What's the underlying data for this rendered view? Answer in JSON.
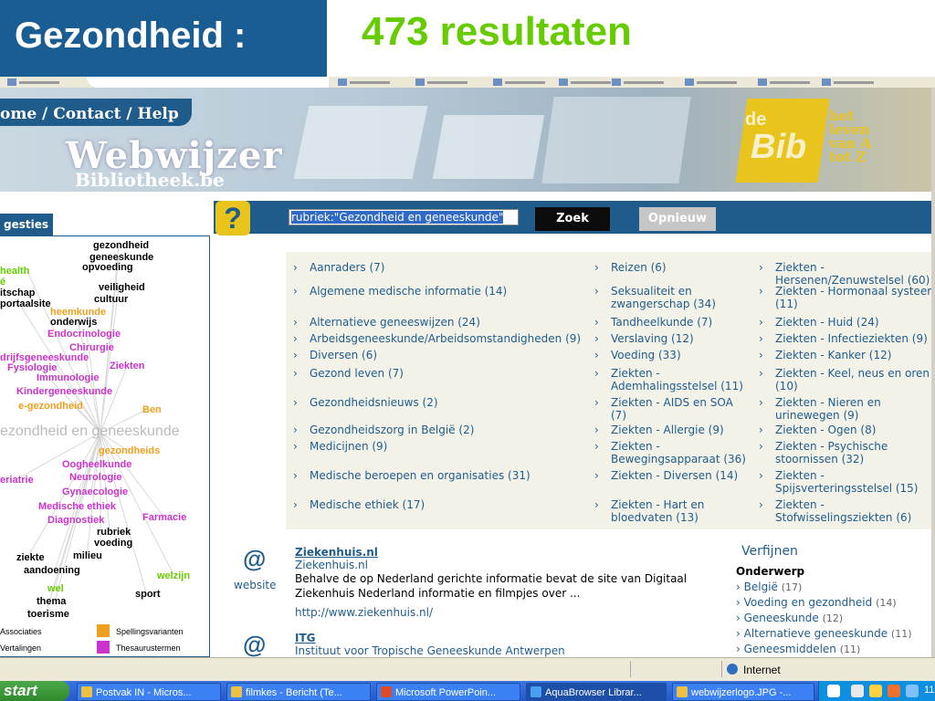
{
  "slide": {
    "title": "Gezondheid :",
    "result_count": "473 resultaten"
  },
  "site": {
    "nav": "ome / Contact / Help",
    "logo_title": "Webwijzer",
    "logo_sub": "Bibliotheek.be",
    "bib_de": "de",
    "bib_logo": "Bib",
    "bib_slogan": [
      "het",
      "leven",
      "van A",
      "tot Z"
    ]
  },
  "search": {
    "query": "rubriek:\"Gezondheid en geneeskunde\"",
    "search_button": "Zoek",
    "reset_button": "Opnieuw"
  },
  "sidebar": {
    "tab": "gesties",
    "center_term": "ezondheid en geneeskunde",
    "cloud": [
      {
        "t": "gezondheid",
        "c": "k"
      },
      {
        "t": "geneeskunde",
        "c": "k"
      },
      {
        "t": "opvoeding",
        "c": "k"
      },
      {
        "t": "health",
        "c": "g"
      },
      {
        "t": "é",
        "c": "g"
      },
      {
        "t": "veiligheid",
        "c": "k"
      },
      {
        "t": "itschap",
        "c": "k"
      },
      {
        "t": "cultuur",
        "c": "k"
      },
      {
        "t": "portaalsite",
        "c": "k"
      },
      {
        "t": "heemkunde",
        "c": "o"
      },
      {
        "t": "onderwijs",
        "c": "k"
      },
      {
        "t": "Endocrinologie",
        "c": "p"
      },
      {
        "t": "Chirurgie",
        "c": "p"
      },
      {
        "t": "drijfsgeneeskunde",
        "c": "p"
      },
      {
        "t": "Fysiologie",
        "c": "p"
      },
      {
        "t": "Ziekten",
        "c": "p"
      },
      {
        "t": "Immunologie",
        "c": "p"
      },
      {
        "t": "Kindergeneeskunde",
        "c": "p"
      },
      {
        "t": "e-gezondheid",
        "c": "o"
      },
      {
        "t": "Ben",
        "c": "o"
      },
      {
        "t": "gezondheids",
        "c": "o"
      },
      {
        "t": "Oogheelkunde",
        "c": "p"
      },
      {
        "t": "Neurologie",
        "c": "p"
      },
      {
        "t": "eriatrie",
        "c": "p"
      },
      {
        "t": "Gynaecologie",
        "c": "p"
      },
      {
        "t": "Medische ethiek",
        "c": "p"
      },
      {
        "t": "Diagnostiek",
        "c": "p"
      },
      {
        "t": "Farmacie",
        "c": "p"
      },
      {
        "t": "rubriek",
        "c": "k"
      },
      {
        "t": "voeding",
        "c": "k"
      },
      {
        "t": "ziekte",
        "c": "k"
      },
      {
        "t": "milieu",
        "c": "k"
      },
      {
        "t": "aandoening",
        "c": "k"
      },
      {
        "t": "welzijn",
        "c": "g"
      },
      {
        "t": "wel",
        "c": "g"
      },
      {
        "t": "sport",
        "c": "k"
      },
      {
        "t": "thema",
        "c": "k"
      },
      {
        "t": "toerisme",
        "c": "k"
      }
    ],
    "legend": [
      {
        "label": "Associaties",
        "color": ""
      },
      {
        "label": "Spellingsvarianten",
        "color": "#f0a020"
      },
      {
        "label": "Vertalingen",
        "color": ""
      },
      {
        "label": "Thesaurustermen",
        "color": "#cc33cc"
      }
    ]
  },
  "categories": [
    [
      "Aanraders (7)",
      "Algemene medische informatie (14)",
      "Alternatieve geneeswijzen (24)",
      "Arbeidsgeneeskunde/Arbeidsomstandigheden (9)",
      "Diversen (6)",
      "Gezond leven (7)",
      "Gezondheidsnieuws (2)",
      "Gezondheidszorg in België (2)",
      "Medicijnen (9)",
      "Medische beroepen en organisaties (31)",
      "Medische ethiek (17)"
    ],
    [
      "Reizen (6)",
      "Seksualiteit en zwangerschap (34)",
      "Tandheelkunde (7)",
      "Verslaving (12)",
      "Voeding (33)",
      "Ziekten - Ademhalingsstelsel (11)",
      "Ziekten - AIDS en SOA (7)",
      "Ziekten - Allergie (9)",
      "Ziekten - Bewegingsapparaat (36)",
      "Ziekten - Diversen (14)",
      "Ziekten - Hart en bloedvaten (13)"
    ],
    [
      "Ziekten - Hersenen/Zenuwstelsel (60)",
      "Ziekten - Hormonaal systeem (11)",
      "Ziekten - Huid (24)",
      "Ziekten - Infectieziekten (9)",
      "Ziekten - Kanker (12)",
      "Ziekten - Keel, neus en oren (10)",
      "Ziekten - Nieren en urinewegen (9)",
      "Ziekten - Ogen (8)",
      "Ziekten - Psychische stoornissen (32)",
      "Ziekten - Spijsverteringsstelsel (15)",
      "Ziekten - Stofwisselingsziekten (6)"
    ]
  ],
  "results": [
    {
      "title": "Ziekenhuis.nl",
      "subtitle": "Ziekenhuis.nl",
      "type": "website",
      "desc": "Behalve de op Nederland gerichte informatie bevat de site van Digitaal Ziekenhuis Nederland informatie en filmpjes over ...",
      "url": "http://www.ziekenhuis.nl/"
    },
    {
      "title": "ITG",
      "subtitle": "Instituut voor Tropische Geneeskunde Antwerpen"
    }
  ],
  "refine": {
    "title": "Verfijnen",
    "subtitle": "Onderwerp",
    "items": [
      {
        "label": "België",
        "count": "(17)"
      },
      {
        "label": "Voeding en gezondheid",
        "count": "(14)"
      },
      {
        "label": "Geneeskunde",
        "count": "(12)"
      },
      {
        "label": "Alternatieve geneeskunde",
        "count": "(11)"
      },
      {
        "label": "Geneesmiddelen",
        "count": "(11)"
      }
    ]
  },
  "status": {
    "zone": "Internet"
  },
  "taskbar": {
    "start": "start",
    "items": [
      "Postvak IN - Micros...",
      "filmkes - Bericht (Te...",
      "Microsoft PowerPoin...",
      "AquaBrowser Librar...",
      "webwijzerlogo.JPG -..."
    ],
    "clock": "11"
  }
}
